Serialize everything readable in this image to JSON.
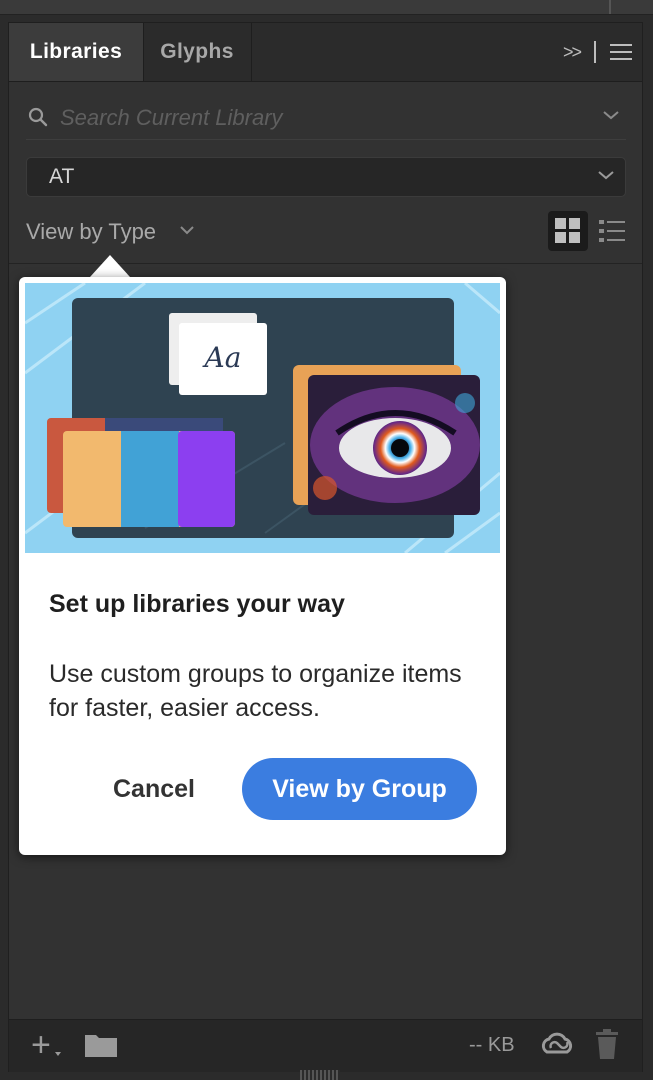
{
  "tabs": [
    {
      "label": "Libraries",
      "active": true
    },
    {
      "label": "Glyphs",
      "active": false
    }
  ],
  "panel_icons": {
    "expand": "double-chevron-right-icon",
    "menu": "hamburger-menu-icon"
  },
  "search": {
    "placeholder": "Search Current Library",
    "value": ""
  },
  "library_select": {
    "value": "AT"
  },
  "view": {
    "label": "View by Type",
    "mode": "grid"
  },
  "dialog": {
    "title": "Set up libraries your way",
    "body": "Use custom groups to organize items for faster, easier access.",
    "illustration_card_text": "Aa",
    "cancel_label": "Cancel",
    "primary_label": "View by Group",
    "primary_color": "#3b7de0"
  },
  "footer": {
    "storage": "-- KB"
  },
  "colors": {
    "panel_bg": "#323232",
    "swatches": [
      "#f2b96e",
      "#41a2d6",
      "#8c3ff0"
    ]
  }
}
